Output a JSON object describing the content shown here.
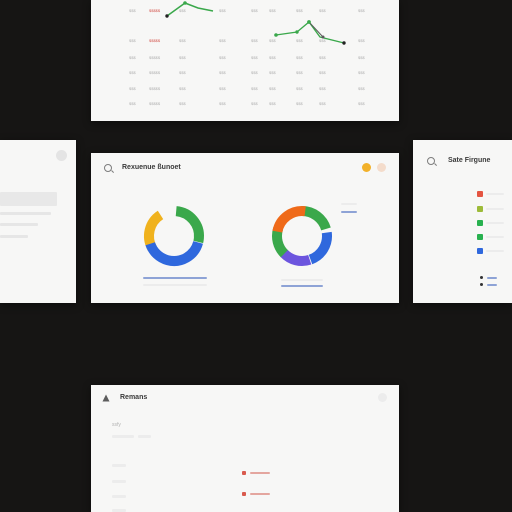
{
  "top_panel": {
    "rows": [
      {
        "c1": "$$$",
        "c2": "$$$$$",
        "c3": "$$$",
        "c4": "$$$",
        "c5": "$$$",
        "c6": "$$$",
        "c7": "$$$",
        "c8": "$$$",
        "c9": "$$$"
      },
      {
        "c1": "$$$",
        "c2": "$$$$$",
        "c3": "$$$",
        "c4": "$$$",
        "c5": "$$$",
        "c6": "$$$",
        "c7": "$$$",
        "c8": "$$$",
        "c9": "$$$"
      },
      {
        "c1": "$$$",
        "c2": "$$$$$",
        "c3": "$$$",
        "c4": "$$$",
        "c5": "$$$",
        "c6": "$$$",
        "c7": "$$$",
        "c8": "$$$",
        "c9": "$$$"
      },
      {
        "c1": "$$$",
        "c2": "$$$$$",
        "c3": "$$$",
        "c4": "$$$",
        "c5": "$$$",
        "c6": "$$$",
        "c7": "$$$",
        "c8": "$$$",
        "c9": "$$$"
      },
      {
        "c1": "$$$",
        "c2": "$$$$$",
        "c3": "$$$",
        "c4": "$$$",
        "c5": "$$$",
        "c6": "$$$",
        "c7": "$$$",
        "c8": "$$$",
        "c9": "$$$"
      },
      {
        "c1": "$$$",
        "c2": "$$$$$",
        "c3": "$$$",
        "c4": "$$$",
        "c5": "$$$",
        "c6": "$$$",
        "c7": "$$$",
        "c8": "$$$",
        "c9": "$$$"
      }
    ]
  },
  "center_panel": {
    "title": "Rexuenue ßunoet",
    "badge_colors": [
      "#f2b12a",
      "#f4dccb"
    ]
  },
  "right_panel": {
    "title": "Sate Firgune",
    "legend_colors": [
      "#e45441",
      "#9dbb39",
      "#28b14f",
      "#28b14f",
      "#2f68dd"
    ]
  },
  "bottom_panel": {
    "title": "Remans",
    "sub_title": "ssfy"
  },
  "colors": {
    "green": "#3aa84b",
    "blue": "#2f68dd",
    "yellow": "#f0b21d",
    "orange": "#ef6a19",
    "purple": "#6c55de",
    "line": "#8ea3d6",
    "red_text": "#d55b54"
  }
}
